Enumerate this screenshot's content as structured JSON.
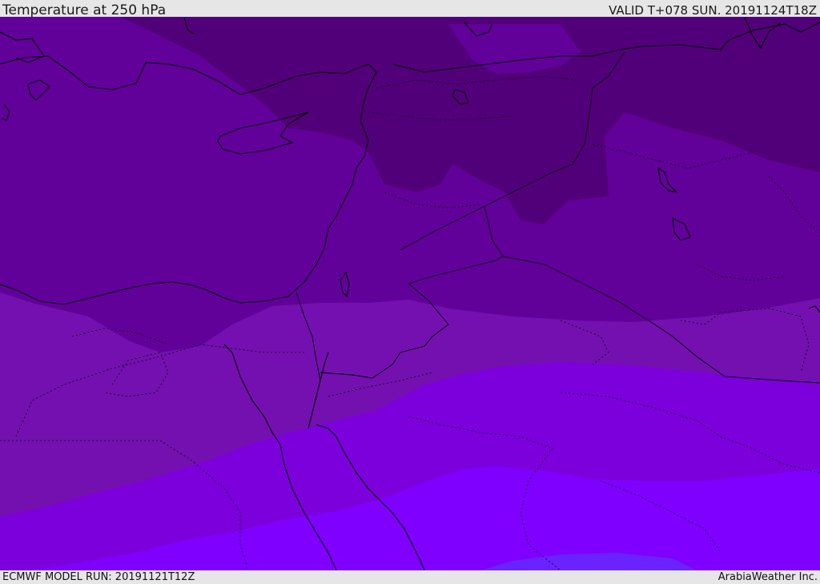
{
  "header": {
    "title": "Temperature at 250 hPa",
    "valid_time": "VALID T+078 SUN. 20191124T18Z"
  },
  "footer": {
    "model_run": "ECMWF MODEL RUN: 20191121T12Z",
    "credit": "ArabiaWeather Inc."
  },
  "map": {
    "temperature_band_colors": [
      "#52007a",
      "#62009a",
      "#7410b0",
      "#7c00dc",
      "#7f00ff",
      "#6a22ff"
    ],
    "coastline_color": "#000000",
    "border_style": "dotted"
  }
}
